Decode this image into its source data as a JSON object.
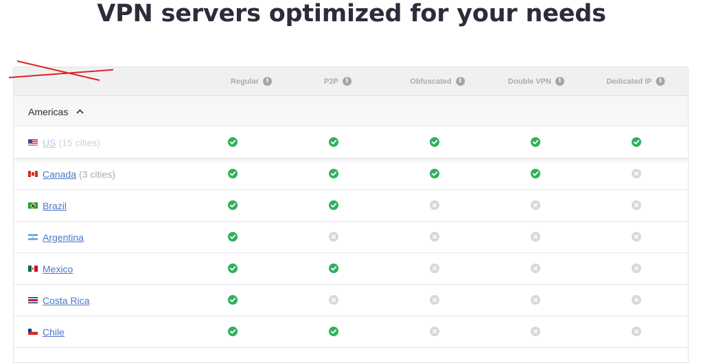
{
  "page": {
    "title": "VPN servers optimized for your needs"
  },
  "columns": [
    {
      "label": "Regular"
    },
    {
      "label": "P2P"
    },
    {
      "label": "Obfuscated"
    },
    {
      "label": "Double VPN"
    },
    {
      "label": "Dedicated IP"
    }
  ],
  "region": {
    "label": "Americas",
    "expanded": true
  },
  "colors": {
    "check": "#2fb15d",
    "unavailable": "#d7d8dc",
    "link": "#4a76c9",
    "strike": "#e02020"
  },
  "rows": [
    {
      "country": "US",
      "cities": "(15 cities)",
      "flag": "us-flag-icon",
      "struck_out": true,
      "support": [
        true,
        true,
        true,
        true,
        true
      ]
    },
    {
      "country": "Canada",
      "cities": "(3 cities)",
      "flag": "canada-flag-icon",
      "struck_out": false,
      "support": [
        true,
        true,
        true,
        true,
        false
      ]
    },
    {
      "country": "Brazil",
      "cities": "",
      "flag": "brazil-flag-icon",
      "struck_out": false,
      "support": [
        true,
        true,
        false,
        false,
        false
      ]
    },
    {
      "country": "Argentina",
      "cities": "",
      "flag": "argentina-flag-icon",
      "struck_out": false,
      "support": [
        true,
        false,
        false,
        false,
        false
      ]
    },
    {
      "country": "Mexico",
      "cities": "",
      "flag": "mexico-flag-icon",
      "struck_out": false,
      "support": [
        true,
        true,
        false,
        false,
        false
      ]
    },
    {
      "country": "Costa Rica",
      "cities": "",
      "flag": "costa-rica-flag-icon",
      "struck_out": false,
      "support": [
        true,
        false,
        false,
        false,
        false
      ]
    },
    {
      "country": "Chile",
      "cities": "",
      "flag": "chile-flag-icon",
      "struck_out": false,
      "support": [
        true,
        true,
        false,
        false,
        false
      ]
    }
  ]
}
